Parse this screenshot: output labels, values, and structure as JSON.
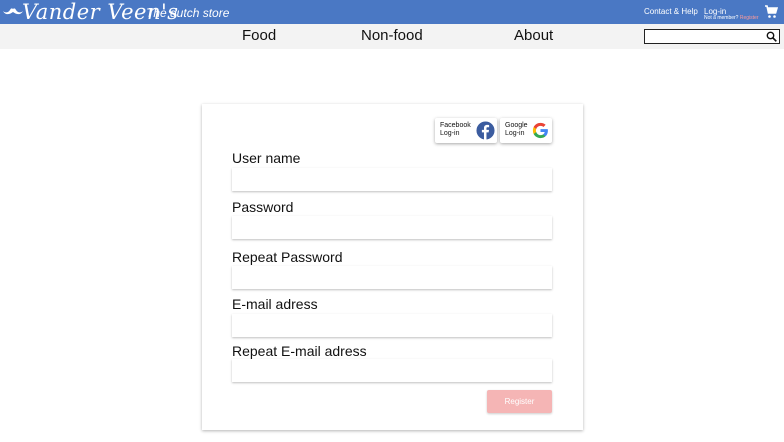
{
  "header": {
    "brand": "Vander Veen's",
    "tagline": "The dutch store",
    "contact_link": "Contact & Help",
    "login_link": "Log-in",
    "member_prefix": "Not a member? ",
    "register_link": "Register",
    "cart_icon": "shopping-cart-icon",
    "logo_icon": "mustache-icon",
    "bar_color": "#4a78c4"
  },
  "nav": {
    "items": [
      {
        "label": "Food"
      },
      {
        "label": "Non-food"
      },
      {
        "label": "About"
      }
    ],
    "search": {
      "placeholder": "",
      "icon": "search-icon"
    }
  },
  "form": {
    "social": {
      "facebook_line1": "Facebook",
      "facebook_line2": "Log-in",
      "google_line1": "Google",
      "google_line2": "Log-in"
    },
    "fields": [
      {
        "label": "User name",
        "value": ""
      },
      {
        "label": "Password",
        "value": ""
      },
      {
        "label": "Repeat Password",
        "value": ""
      },
      {
        "label": "E-mail adress",
        "value": ""
      },
      {
        "label": "Repeat E-mail adress",
        "value": ""
      }
    ],
    "register_label": "Register",
    "register_color": "#f5b5b5"
  }
}
